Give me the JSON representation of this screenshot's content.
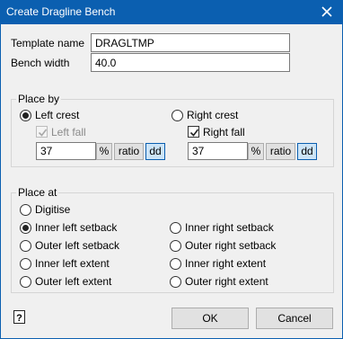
{
  "window": {
    "title": "Create Dragline Bench",
    "close_icon": "close-icon"
  },
  "template": {
    "label": "Template name",
    "value": "DRAGLTMP"
  },
  "bench": {
    "label": "Bench width",
    "value": "40.0"
  },
  "place_by": {
    "title": "Place by",
    "left_crest": "Left crest",
    "right_crest": "Right crest",
    "selected": "Left crest",
    "left_fall": {
      "label": "Left fall",
      "checked": true,
      "enabled": false,
      "value": "37"
    },
    "right_fall": {
      "label": "Right fall",
      "checked": true,
      "enabled": true,
      "value": "37"
    },
    "buttons": {
      "percent": "%",
      "ratio": "ratio",
      "degrees": "dd"
    }
  },
  "place_at": {
    "title": "Place at",
    "selected": "Inner left setback",
    "options": {
      "digitise": "Digitise",
      "inner_left_setback": "Inner left setback",
      "inner_right_setback": "Inner right setback",
      "outer_left_setback": "Outer left setback",
      "outer_right_setback": "Outer right setback",
      "inner_left_extent": "Inner left extent",
      "inner_right_extent": "Inner right extent",
      "outer_left_extent": "Outer left extent",
      "outer_right_extent": "Outer right extent"
    }
  },
  "footer": {
    "ok": "OK",
    "cancel": "Cancel",
    "help_icon": "help-icon"
  },
  "colors": {
    "titlebar": "#0b5fb0",
    "background": "#f0f0f0",
    "active_toggle": "#cce4f7"
  }
}
